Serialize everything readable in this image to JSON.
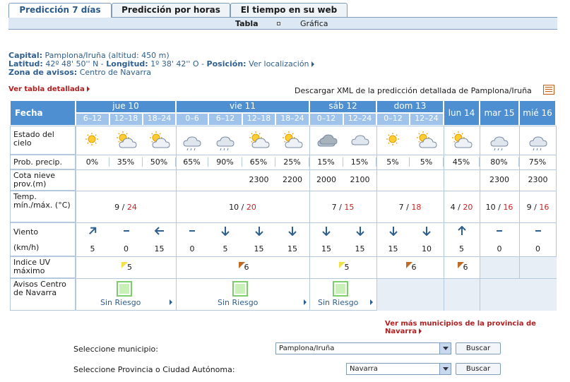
{
  "tabs": [
    "Predicción 7 días",
    "Predicción por horas",
    "El tiempo en su web"
  ],
  "subnav": {
    "tabla": "Tabla",
    "grafica": "Gráfica"
  },
  "info": {
    "capital_label": "Capital:",
    "capital_value": "Pamplona/Iruña (altitud: 450 m)",
    "lat_label": "Latitud:",
    "lat_value": "42º 48' 50'' N",
    "lon_label": "Longitud:",
    "lon_value": "1º 38' 42'' O",
    "pos_label": "Posición:",
    "pos_value": "Ver localización",
    "zona_label": "Zona de avisos:",
    "zona_value": "Centro de Navarra"
  },
  "links": {
    "tabla_detallada": "Ver tabla detallada",
    "xml": "Descargar XML de la predicción detallada de Pamplona/Iruña",
    "mas_municipios": "Ver más municipios de la provincia de Navarra"
  },
  "table": {
    "fecha": "Fecha",
    "days": [
      "jue 10",
      "vie 11",
      "sáb 12",
      "dom 13",
      "lun 14",
      "mar 15",
      "mié 16"
    ],
    "periods": [
      "6–12",
      "12–18",
      "18–24",
      "0–6",
      "6–12",
      "12–18",
      "18–24",
      "0–12",
      "12–24",
      "0–12",
      "12–24"
    ],
    "row_labels": {
      "estado": "Estado del cielo",
      "prob": "Prob. precip.",
      "cota": "Cota nieve prov.(m)",
      "temp": "Temp. mín./máx. (°C)",
      "viento": "Viento",
      "kmh": "(km/h)",
      "uv": "Indice UV máximo",
      "avisos": "Avisos Centro de Navarra"
    },
    "sky_icons": [
      "sun-icon",
      "sun-cloud-icon",
      "sun-cloud-icon",
      "rain-cloud-icon",
      "rain-cloud-icon",
      "sun-cloud-icon",
      "sun-cloud-icon",
      "overcast-icon",
      "cloud-icon",
      "sun-icon",
      "sun-cloud-icon",
      "sun-cloud-icon",
      "rain-cloud-icon",
      "rain-cloud-icon"
    ],
    "prob": [
      "0%",
      "35%",
      "50%",
      "65%",
      "90%",
      "65%",
      "25%",
      "15%",
      "15%",
      "5%",
      "5%",
      "45%",
      "80%",
      "75%"
    ],
    "cota": [
      "",
      "",
      "",
      "",
      "",
      "2300",
      "2200",
      "2000",
      "2100",
      "",
      "",
      "",
      "2300",
      "2300"
    ],
    "temp": [
      {
        "min": "9",
        "max": "24"
      },
      {
        "min": "10",
        "max": "20"
      },
      {
        "min": "7",
        "max": "15"
      },
      {
        "min": "7",
        "max": "18"
      },
      {
        "min": "4",
        "max": "20"
      },
      {
        "min": "10",
        "max": "16"
      },
      {
        "min": "9",
        "max": "16"
      }
    ],
    "wind_dirs": [
      "northeast-arrow-icon",
      "calm-icon",
      "west-arrow-icon",
      "calm-icon",
      "south-arrow-icon",
      "south-arrow-icon",
      "south-arrow-icon",
      "south-arrow-icon",
      "south-arrow-icon",
      "south-arrow-icon",
      "south-arrow-icon",
      "north-arrow-icon",
      "calm-icon",
      "calm-icon"
    ],
    "wind_speed": [
      "5",
      "0",
      "15",
      "0",
      "5",
      "15",
      "15",
      "15",
      "15",
      "15",
      "10",
      "5",
      "0",
      "0"
    ],
    "uv": [
      "5",
      "6",
      "5",
      "6",
      "6"
    ],
    "avisos": [
      "Sin Riesgo",
      "Sin Riesgo",
      "Sin Riesgo"
    ]
  },
  "form": {
    "municipio_label": "Seleccione municipio:",
    "municipio_value": "Pamplona/Iruña",
    "provincia_label": "Seleccione Provincia o Ciudad Autónoma:",
    "provincia_value": "Navarra",
    "buscar": "Buscar"
  },
  "colors": {
    "header": "#4d8fd1",
    "subheader": "#9fc3ea",
    "link_blue": "#2f5f8f",
    "link_red": "#b02020",
    "max_temp": "#cc2222"
  }
}
